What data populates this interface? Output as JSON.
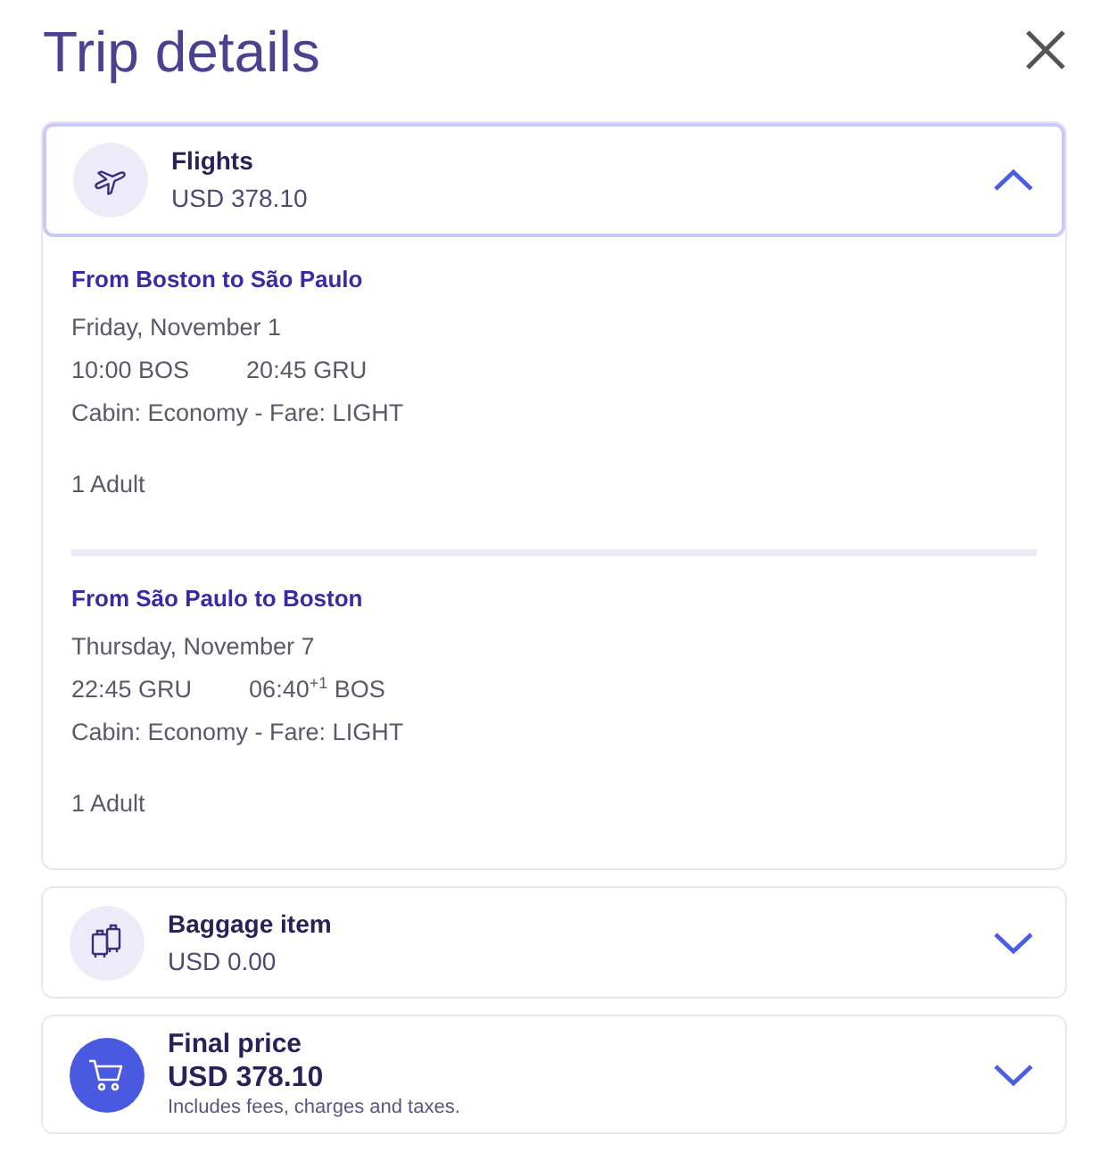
{
  "header": {
    "title": "Trip details"
  },
  "sections": [
    {
      "kind": "flights",
      "title": "Flights",
      "amount": "USD 378.10",
      "expanded": true,
      "segments": [
        {
          "route": "From Boston to São Paulo",
          "date": "Friday, November 1",
          "departure": "10:00 BOS",
          "arrival": "20:45 GRU",
          "cabin": "Cabin: Economy - Fare: LIGHT",
          "passengers": "1 Adult"
        },
        {
          "route": "From São Paulo to Boston",
          "date": "Thursday, November 7",
          "departure": "22:45 GRU",
          "arrival": "06:40$^{+1}$ BOS",
          "cabin": "Cabin: Economy - Fare: LIGHT",
          "passengers": "1 Adult"
        }
      ]
    },
    {
      "kind": "baggage",
      "title": "Baggage item",
      "amount": "USD 0.00",
      "expanded": false
    },
    {
      "kind": "total",
      "title": "Final price",
      "amount": "USD 378.10",
      "note": "Includes fees, charges and taxes.",
      "expanded": false
    }
  ]
}
